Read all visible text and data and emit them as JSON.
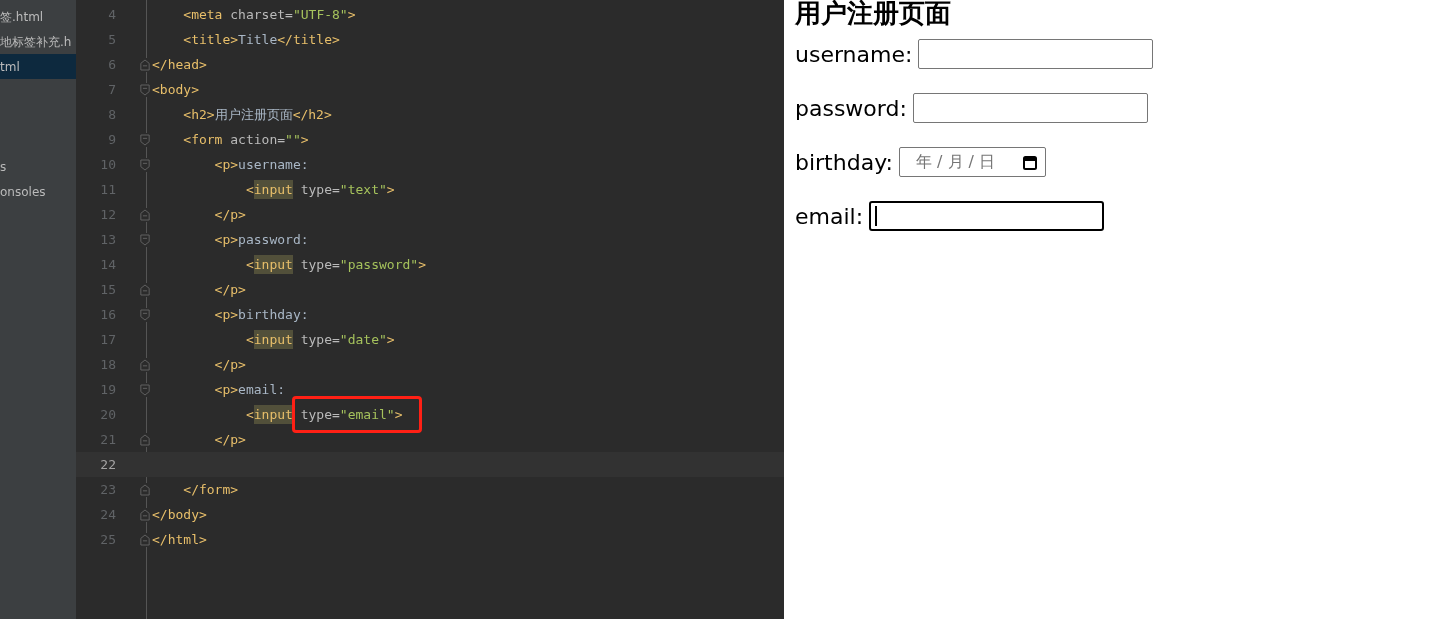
{
  "project_tree": {
    "items": [
      {
        "label": "签.html",
        "selected": false
      },
      {
        "label": "地标签补充.h",
        "selected": false
      },
      {
        "label": "tml",
        "selected": true
      },
      {
        "label": "s",
        "selected": false
      },
      {
        "label": "onsoles",
        "selected": false
      }
    ]
  },
  "editor": {
    "lines": [
      {
        "number": "4",
        "fold_start": false,
        "fold_end": false,
        "current": false,
        "segments": [
          {
            "kind": "tag",
            "text": "    <meta "
          },
          {
            "kind": "attr",
            "text": "charset="
          },
          {
            "kind": "string",
            "text": "\"UTF-8\""
          },
          {
            "kind": "tag",
            "text": ">"
          }
        ]
      },
      {
        "number": "5",
        "fold_start": false,
        "fold_end": false,
        "current": false,
        "segments": [
          {
            "kind": "tag",
            "text": "    <title>"
          },
          {
            "kind": "text",
            "text": "Title"
          },
          {
            "kind": "tag",
            "text": "</title>"
          }
        ]
      },
      {
        "number": "6",
        "fold_start": false,
        "fold_end": true,
        "current": false,
        "segments": [
          {
            "kind": "tag",
            "text": "</head>"
          }
        ]
      },
      {
        "number": "7",
        "fold_start": true,
        "fold_end": false,
        "current": false,
        "segments": [
          {
            "kind": "tag",
            "text": "<body>"
          }
        ]
      },
      {
        "number": "8",
        "fold_start": false,
        "fold_end": false,
        "current": false,
        "segments": [
          {
            "kind": "tag",
            "text": "    <h2>"
          },
          {
            "kind": "text",
            "text": "用户注册页面"
          },
          {
            "kind": "tag",
            "text": "</h2>"
          }
        ]
      },
      {
        "number": "9",
        "fold_start": true,
        "fold_end": false,
        "current": false,
        "segments": [
          {
            "kind": "tag",
            "text": "    <form "
          },
          {
            "kind": "attr",
            "text": "action="
          },
          {
            "kind": "string",
            "text": "\"\""
          },
          {
            "kind": "tag",
            "text": ">"
          }
        ]
      },
      {
        "number": "10",
        "fold_start": true,
        "fold_end": false,
        "current": false,
        "segments": [
          {
            "kind": "tag",
            "text": "        <p>"
          },
          {
            "kind": "text",
            "text": "username:"
          }
        ]
      },
      {
        "number": "11",
        "fold_start": false,
        "fold_end": false,
        "current": false,
        "segments": [
          {
            "kind": "tag",
            "text": "            <"
          },
          {
            "kind": "match",
            "text": "input"
          },
          {
            "kind": "attr",
            "text": " type="
          },
          {
            "kind": "string",
            "text": "\"text\""
          },
          {
            "kind": "tag",
            "text": ">"
          }
        ]
      },
      {
        "number": "12",
        "fold_start": false,
        "fold_end": true,
        "current": false,
        "segments": [
          {
            "kind": "tag",
            "text": "        </p>"
          }
        ]
      },
      {
        "number": "13",
        "fold_start": true,
        "fold_end": false,
        "current": false,
        "segments": [
          {
            "kind": "tag",
            "text": "        <p>"
          },
          {
            "kind": "text",
            "text": "password:"
          }
        ]
      },
      {
        "number": "14",
        "fold_start": false,
        "fold_end": false,
        "current": false,
        "segments": [
          {
            "kind": "tag",
            "text": "            <"
          },
          {
            "kind": "match",
            "text": "input"
          },
          {
            "kind": "attr",
            "text": " type="
          },
          {
            "kind": "string",
            "text": "\"password\""
          },
          {
            "kind": "tag",
            "text": ">"
          }
        ]
      },
      {
        "number": "15",
        "fold_start": false,
        "fold_end": true,
        "current": false,
        "segments": [
          {
            "kind": "tag",
            "text": "        </p>"
          }
        ]
      },
      {
        "number": "16",
        "fold_start": true,
        "fold_end": false,
        "current": false,
        "segments": [
          {
            "kind": "tag",
            "text": "        <p>"
          },
          {
            "kind": "text",
            "text": "birthday:"
          }
        ]
      },
      {
        "number": "17",
        "fold_start": false,
        "fold_end": false,
        "current": false,
        "segments": [
          {
            "kind": "tag",
            "text": "            <"
          },
          {
            "kind": "match",
            "text": "input"
          },
          {
            "kind": "attr",
            "text": " type="
          },
          {
            "kind": "string",
            "text": "\"date\""
          },
          {
            "kind": "tag",
            "text": ">"
          }
        ]
      },
      {
        "number": "18",
        "fold_start": false,
        "fold_end": true,
        "current": false,
        "segments": [
          {
            "kind": "tag",
            "text": "        </p>"
          }
        ]
      },
      {
        "number": "19",
        "fold_start": true,
        "fold_end": false,
        "current": false,
        "segments": [
          {
            "kind": "tag",
            "text": "        <p>"
          },
          {
            "kind": "text",
            "text": "email:"
          }
        ]
      },
      {
        "number": "20",
        "fold_start": false,
        "fold_end": false,
        "current": false,
        "segments": [
          {
            "kind": "tag",
            "text": "            <"
          },
          {
            "kind": "match",
            "text": "input"
          },
          {
            "kind": "attr",
            "text": " type=",
            "annotated": true
          },
          {
            "kind": "string",
            "text": "\"email\"",
            "annotated": true
          },
          {
            "kind": "tag",
            "text": ">",
            "annotated": true
          }
        ]
      },
      {
        "number": "21",
        "fold_start": false,
        "fold_end": true,
        "current": false,
        "segments": [
          {
            "kind": "tag",
            "text": "        </p>"
          }
        ]
      },
      {
        "number": "22",
        "fold_start": false,
        "fold_end": false,
        "current": true
      },
      {
        "number": "23",
        "fold_start": false,
        "fold_end": true,
        "current": false,
        "segments": [
          {
            "kind": "tag",
            "text": "    </form>"
          }
        ]
      },
      {
        "number": "24",
        "fold_start": false,
        "fold_end": true,
        "current": false,
        "segments": [
          {
            "kind": "tag",
            "text": "</body>"
          }
        ]
      },
      {
        "number": "25",
        "fold_start": false,
        "fold_end": true,
        "current": false,
        "segments": [
          {
            "kind": "tag",
            "text": "</html>"
          }
        ]
      }
    ]
  },
  "preview": {
    "heading": "用户注册页面",
    "fields": [
      {
        "label": "username:",
        "kind": "text",
        "focused": false
      },
      {
        "label": "password:",
        "kind": "password",
        "focused": false
      },
      {
        "label": "birthday:",
        "kind": "date",
        "focused": false,
        "parts": [
          "年",
          "/",
          "月",
          "/",
          "日"
        ]
      },
      {
        "label": "email:",
        "kind": "email",
        "focused": true
      }
    ]
  }
}
